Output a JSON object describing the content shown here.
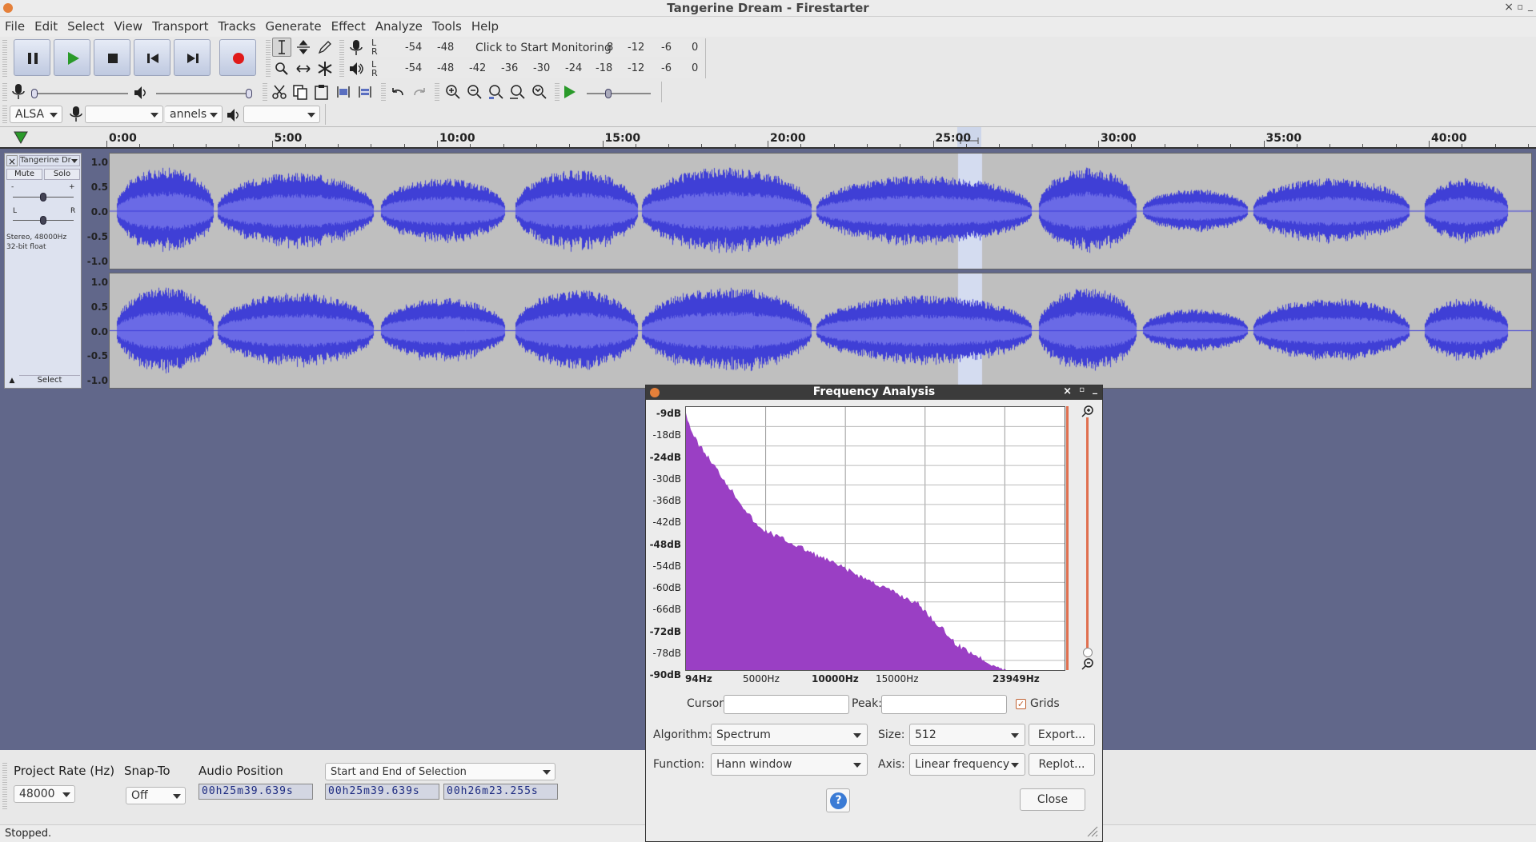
{
  "window": {
    "title": "Tangerine Dream - Firestarter"
  },
  "menu": [
    "File",
    "Edit",
    "Select",
    "View",
    "Transport",
    "Tracks",
    "Generate",
    "Effect",
    "Analyze",
    "Tools",
    "Help"
  ],
  "meters": {
    "rec": {
      "L": "L",
      "R": "R",
      "ticks": [
        "-54",
        "-48"
      ],
      "prompt": "Click to Start Monitoring",
      "ticks2": [
        "-12",
        "-6",
        "0"
      ],
      "partial": "8"
    },
    "play": {
      "L": "L",
      "R": "R",
      "ticks": [
        "-54",
        "-48",
        "-42",
        "-36",
        "-30",
        "-24",
        "-18",
        "-12",
        "-6",
        "0"
      ]
    }
  },
  "device": {
    "host": "ALSA",
    "channels": "annels"
  },
  "ruler": [
    "0:00",
    "5:00",
    "10:00",
    "15:00",
    "20:00",
    "25:00",
    "30:00",
    "35:00",
    "40:00"
  ],
  "track": {
    "name": "Tangerine Dr",
    "mute": "Mute",
    "solo": "Solo",
    "gain_minus": "-",
    "gain_plus": "+",
    "pan_l": "L",
    "pan_r": "R",
    "info1": "Stereo, 48000Hz",
    "info2": "32-bit float",
    "select": "Select",
    "scale": [
      "1.0",
      "0.5",
      "0.0",
      "-0.5",
      "-1.0"
    ]
  },
  "bottom": {
    "rate_label": "Project Rate (Hz)",
    "rate_value": "48000",
    "snap_label": "Snap-To",
    "snap_value": "Off",
    "pos_label": "Audio Position",
    "pos_value": "00h25m39.639s",
    "sel_mode": "Start and End of Selection",
    "sel_start": "00h25m39.639s",
    "sel_end": "00h26m23.255s"
  },
  "status": "Stopped.",
  "dialog": {
    "title": "Frequency Analysis",
    "ylabels": [
      {
        "t": "-9dB",
        "b": true
      },
      {
        "t": "-18dB",
        "b": false
      },
      {
        "t": "-24dB",
        "b": true
      },
      {
        "t": "-30dB",
        "b": false
      },
      {
        "t": "-36dB",
        "b": false
      },
      {
        "t": "-42dB",
        "b": false
      },
      {
        "t": "-48dB",
        "b": true
      },
      {
        "t": "-54dB",
        "b": false
      },
      {
        "t": "-60dB",
        "b": false
      },
      {
        "t": "-66dB",
        "b": false
      },
      {
        "t": "-72dB",
        "b": true
      },
      {
        "t": "-78dB",
        "b": false
      },
      {
        "t": "-90dB",
        "b": true
      }
    ],
    "xlabels": [
      {
        "t": "94Hz",
        "b": true
      },
      {
        "t": "5000Hz",
        "b": false
      },
      {
        "t": "10000Hz",
        "b": true
      },
      {
        "t": "15000Hz",
        "b": false
      },
      {
        "t": "23949Hz",
        "b": true
      }
    ],
    "cursor_label": "Cursor:",
    "cursor_value": "",
    "peak_label": "Peak:",
    "peak_value": "",
    "grids_label": "Grids",
    "grids_checked": true,
    "algorithm_label": "Algorithm:",
    "algorithm_value": "Spectrum",
    "size_label": "Size:",
    "size_value": "512",
    "export_label": "Export...",
    "function_label": "Function:",
    "function_value": "Hann window",
    "axis_label": "Axis:",
    "axis_value": "Linear frequency",
    "replot_label": "Replot...",
    "help_label": "?",
    "close_label": "Close",
    "spectrum_color": "#9a3fc4"
  },
  "colors": {
    "waveform": "#3f3fd6",
    "waveform_light": "#6a6ae6",
    "clip_bg": "#bfbfbf",
    "selection": "#d4dcf0",
    "accent": "#e07050"
  }
}
